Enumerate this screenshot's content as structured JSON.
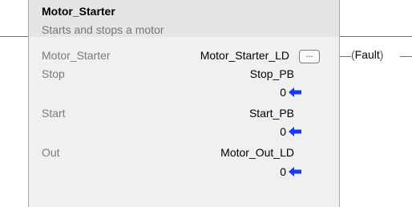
{
  "block": {
    "name": "Motor_Starter",
    "description": "Starts and stops a motor",
    "params": [
      {
        "label": "Motor_Starter",
        "tag": "Motor_Starter_LD"
      },
      {
        "label": "Stop",
        "tag": "Stop_PB",
        "value": "0"
      },
      {
        "label": "Start",
        "tag": "Start_PB",
        "value": "0"
      },
      {
        "label": "Out",
        "tag": "Motor_Out_LD",
        "value": "0"
      }
    ],
    "browse_button_label": "...",
    "arrow_color": "#1a3cf0"
  },
  "fault_coil": {
    "label": "Fault"
  }
}
